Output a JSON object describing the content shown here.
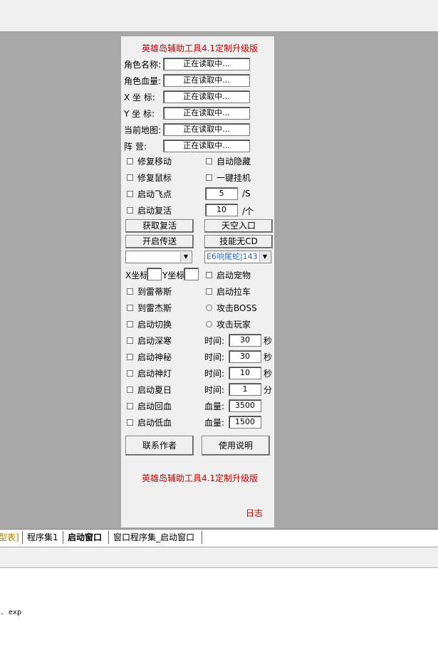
{
  "panel": {
    "title": "英雄岛辅助工具4.1定制升级版",
    "footer_title": "英雄岛辅助工具4.1定制升级版",
    "log_link": "日志"
  },
  "info_rows": [
    {
      "label": "角色名称:",
      "value": "正在读取中..."
    },
    {
      "label": "角色血量:",
      "value": "正在读取中..."
    },
    {
      "label": "X 坐  标:",
      "value": "正在读取中..."
    },
    {
      "label": "Y 坐  标:",
      "value": "正在读取中..."
    },
    {
      "label": "当前地图:",
      "value": "正在读取中..."
    },
    {
      "label": "阵    营:",
      "value": "正在读取中..."
    }
  ],
  "left_checks_top": [
    "修复移动",
    "修复鼠标",
    "启动飞点",
    "启动复活"
  ],
  "right_checks_top": [
    "自动隐藏",
    "一键挂机"
  ],
  "fly_speed": {
    "value": "5",
    "unit": "/S"
  },
  "revive_count": {
    "value": "10",
    "unit": "/个"
  },
  "buttons": {
    "get_revive": "获取复活",
    "sky_entry": "天空入口",
    "open_teleport": "开启传送",
    "skill_no_cd": "技能无CD",
    "contact_author": "联系作者",
    "instructions": "使用说明"
  },
  "combo_left": "",
  "combo_right": "E6响尾蛇|143",
  "coord_labels": {
    "x": "X坐标",
    "y": "Y坐标"
  },
  "left_checks_mid": [
    "到雷蒂斯",
    "到雷杰斯",
    "启动切换"
  ],
  "right_checks_mid": [
    "启动宠物",
    "启动拉车"
  ],
  "radios": [
    "攻击BOSS",
    "攻击玩家"
  ],
  "timed_rows": [
    {
      "check": "启动深寒",
      "label": "时间:",
      "value": "30",
      "unit": "秒"
    },
    {
      "check": "启动神秘",
      "label": "时间:",
      "value": "30",
      "unit": "秒"
    },
    {
      "check": "启动神灯",
      "label": "时间:",
      "value": "10",
      "unit": "秒"
    },
    {
      "check": "启动夏日",
      "label": "时间:",
      "value": "1",
      "unit": "分"
    },
    {
      "check": "启动回血",
      "label": "血量:",
      "value": "3500",
      "unit": ""
    },
    {
      "check": "启动低血",
      "label": "血量:",
      "value": "1500",
      "unit": ""
    }
  ],
  "tabs": [
    "型表]",
    "程序集1",
    "启动窗口",
    "窗口程序集_启动窗口"
  ],
  "output_text": ". exp"
}
